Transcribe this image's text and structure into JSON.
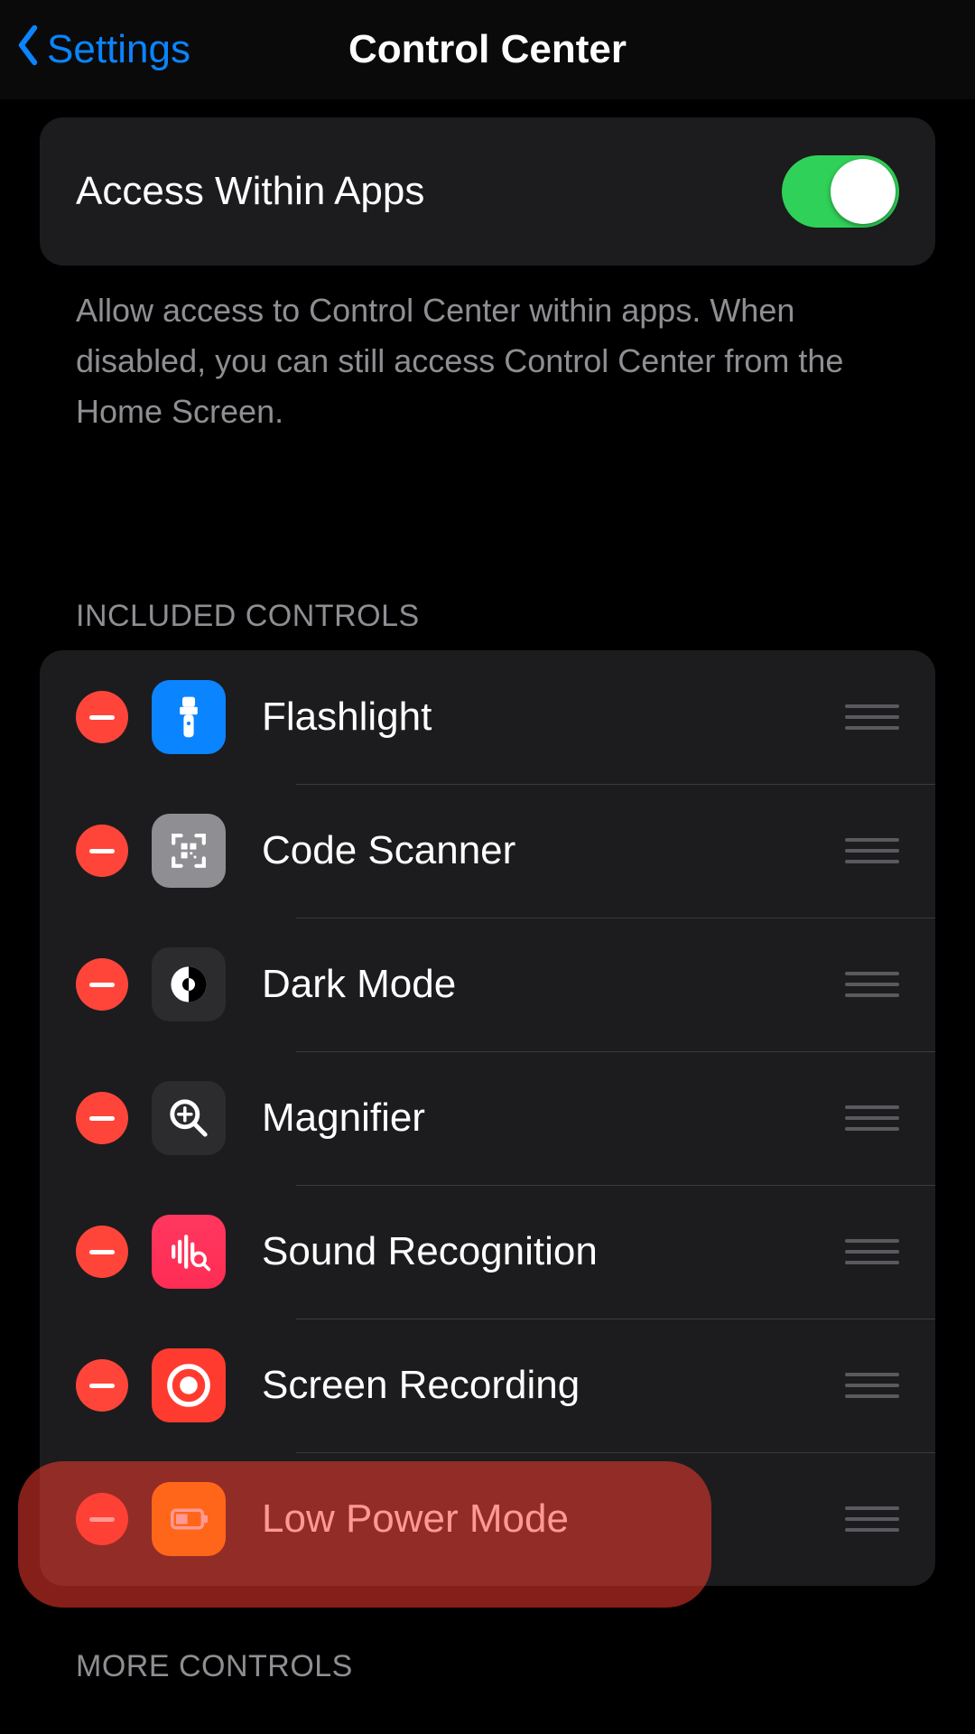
{
  "nav": {
    "back_label": "Settings",
    "title": "Control Center"
  },
  "access": {
    "label": "Access Within Apps",
    "enabled": true,
    "description": "Allow access to Control Center within apps. When disabled, you can still access Control Center from the Home Screen."
  },
  "sections": {
    "included_header": "INCLUDED CONTROLS",
    "more_header": "MORE CONTROLS"
  },
  "included": [
    {
      "label": "Flashlight",
      "icon": "flashlight-icon",
      "bg": "bg-blue",
      "highlighted": false
    },
    {
      "label": "Code Scanner",
      "icon": "qr-icon",
      "bg": "bg-gray",
      "highlighted": false
    },
    {
      "label": "Dark Mode",
      "icon": "darkmode-icon",
      "bg": "bg-dark",
      "highlighted": false
    },
    {
      "label": "Magnifier",
      "icon": "magnifier-icon",
      "bg": "bg-dark",
      "highlighted": false
    },
    {
      "label": "Sound Recognition",
      "icon": "sound-recognition-icon",
      "bg": "bg-pink",
      "highlighted": false
    },
    {
      "label": "Screen Recording",
      "icon": "screen-recording-icon",
      "bg": "bg-red",
      "highlighted": false
    },
    {
      "label": "Low Power Mode",
      "icon": "low-power-icon",
      "bg": "bg-orange",
      "highlighted": true
    }
  ],
  "colors": {
    "accent_blue": "#0a84ff",
    "toggle_green": "#30d158",
    "remove_red": "#ff453a",
    "highlight_red": "rgba(255,59,48,0.52)"
  }
}
